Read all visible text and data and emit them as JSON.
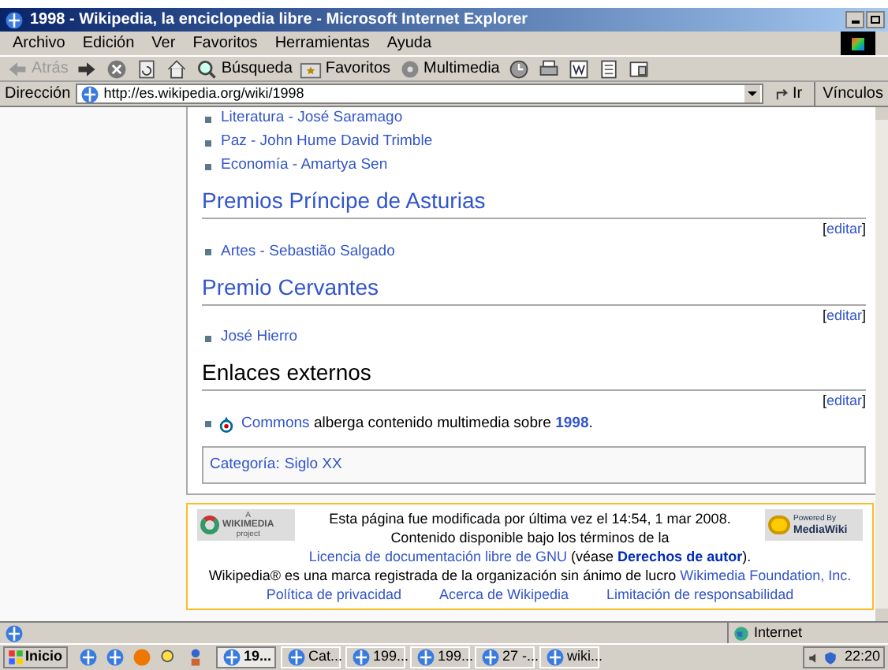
{
  "window": {
    "title": "1998 - Wikipedia, la enciclopedia libre - Microsoft Internet Explorer"
  },
  "menu": [
    "Archivo",
    "Edición",
    "Ver",
    "Favoritos",
    "Herramientas",
    "Ayuda"
  ],
  "toolbar": [
    {
      "kind": "back",
      "label": "Atrás",
      "disabled": true
    },
    {
      "kind": "forward",
      "disabled": false
    },
    {
      "kind": "stop"
    },
    {
      "kind": "refresh"
    },
    {
      "kind": "home"
    },
    {
      "kind": "search",
      "label": "Búsqueda"
    },
    {
      "kind": "favorites",
      "label": "Favoritos"
    },
    {
      "kind": "media",
      "label": "Multimedia"
    },
    {
      "kind": "history"
    },
    {
      "kind": "print"
    },
    {
      "kind": "word"
    },
    {
      "kind": "edit"
    },
    {
      "kind": "discuss"
    }
  ],
  "address": {
    "label": "Dirección",
    "value": "http://es.wikipedia.org/wiki/1998",
    "go": "Ir",
    "links": "Vínculos"
  },
  "sections": [
    {
      "items": [
        {
          "text": "Literatura - José Saramago"
        },
        {
          "text": "Paz - John Hume David Trimble"
        },
        {
          "text": "Economía - Amartya Sen"
        }
      ]
    },
    {
      "heading": "Premios Príncipe de Asturias",
      "linked": true,
      "edit": {
        "open": "[",
        "label": "editar",
        "close": "]"
      },
      "items": [
        {
          "text": "Artes - Sebastião Salgado"
        }
      ]
    },
    {
      "heading": "Premio Cervantes",
      "linked": true,
      "edit": {
        "open": "[",
        "label": "editar",
        "close": "]"
      },
      "items": [
        {
          "text": "José Hierro"
        }
      ]
    },
    {
      "heading": "Enlaces externos",
      "linked": false,
      "edit": {
        "open": "[",
        "label": "editar",
        "close": "]"
      },
      "commons": {
        "link": "Commons",
        "text": "alberga contenido multimedia sobre",
        "topic": "1998",
        "end": "."
      }
    }
  ],
  "categories": {
    "label": "Categoría:",
    "items": [
      "Siglo XX"
    ]
  },
  "footer": {
    "wikimedia_logo": {
      "top": "A",
      "name": "WIKIMEDIA",
      "bottom": "project"
    },
    "mediawiki_logo": {
      "top": "Powered By",
      "name": "MediaWiki"
    },
    "paragraph": [
      {
        "kind": "text",
        "text": "Esta página fue modificada por última vez el 14:54, 1 mar 2008."
      },
      {
        "kind": "text",
        "text": "Contenido disponible bajo los términos de la"
      },
      {
        "kind": "link",
        "text": "Licencia de documentación libre de GNU"
      },
      {
        "kind": "text",
        "text": "(véase"
      },
      {
        "kind": "bold-link",
        "text": "Derechos de autor"
      },
      {
        "kind": "text",
        "text": ")."
      }
    ],
    "trademark": {
      "text": "Wikipedia® es una marca registrada de la organización sin ánimo de lucro",
      "link": "Wikimedia Foundation, Inc."
    },
    "links": [
      "Política de privacidad",
      "Acerca de Wikipedia",
      "Limitación de responsabilidad"
    ]
  },
  "status_bar": {
    "zone": "Internet"
  },
  "taskbar": {
    "start": "Inicio",
    "windows": [
      {
        "label": "19...",
        "selected": true
      },
      {
        "label": "Cat...",
        "selected": false
      },
      {
        "label": "199...",
        "selected": false
      },
      {
        "label": "199...",
        "selected": false
      },
      {
        "label": "27 -...",
        "selected": false
      },
      {
        "label": "wiki...",
        "selected": false
      }
    ],
    "clock": "22:20"
  }
}
